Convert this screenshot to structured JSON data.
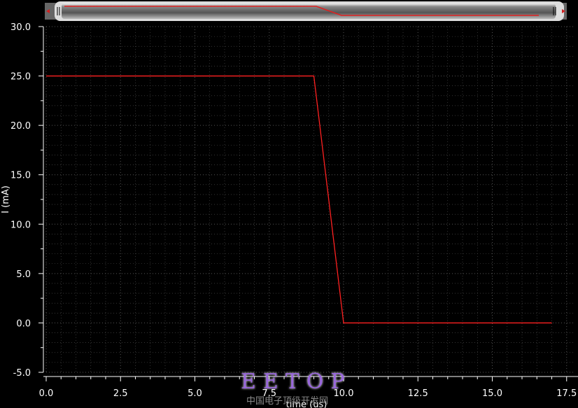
{
  "chart_data": {
    "type": "line",
    "xlabel": "time (us)",
    "ylabel": "I (mA)",
    "xlim": [
      0,
      17.5
    ],
    "ylim": [
      -5,
      30
    ],
    "xticks": [
      "0.0",
      "2.5",
      "5.0",
      "7.5",
      "10.0",
      "12.5",
      "15.0",
      "17.5"
    ],
    "yticks": [
      "30.0",
      "25.0",
      "20.0",
      "15.0",
      "10.0",
      "5.0",
      "0.0",
      "-5.0"
    ],
    "grid": true,
    "series": [
      {
        "color": "#ff2020",
        "x": [
          0,
          9,
          10,
          17
        ],
        "y": [
          25,
          25,
          0,
          0
        ]
      }
    ]
  },
  "colors": {
    "background": "#000000",
    "trace": "#ff2020",
    "grid": "#555555"
  },
  "watermark": {
    "logo": "EETOP",
    "subtitle": "中国电子顶级开发网"
  },
  "scroller": {
    "left_handle_icon": "grip-icon",
    "right_handle_icon": "grip-icon"
  }
}
